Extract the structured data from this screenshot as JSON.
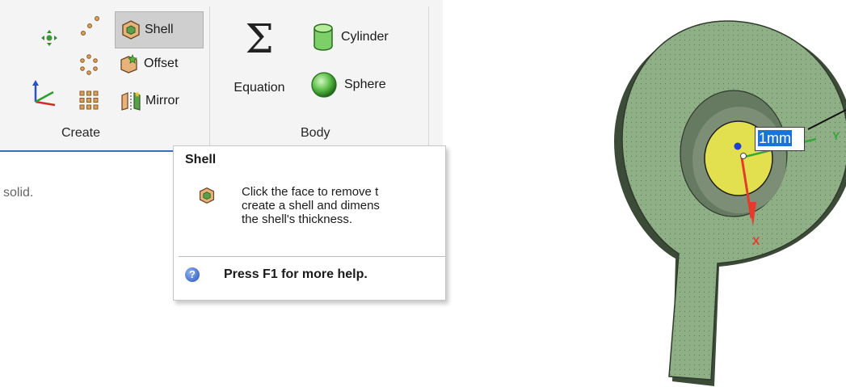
{
  "ribbon": {
    "create_group": {
      "label": "Create",
      "shell_label": "Shell",
      "offset_label": "Offset",
      "mirror_label": "Mirror"
    },
    "body_group": {
      "label": "Body",
      "equation_label": "Equation",
      "cylinder_label": "Cylinder",
      "sphere_label": "Sphere",
      "equation_symbol": "Σ"
    }
  },
  "status": {
    "text": "solid."
  },
  "tooltip": {
    "title": "Shell",
    "description_lines": [
      "Click the face to remove t",
      "create a shell and dimens",
      "the shell's thickness."
    ],
    "help_text": "Press F1 for more help.",
    "help_icon_glyph": "?"
  },
  "viewport": {
    "dimension_value": "1mm",
    "axis_x": "X",
    "axis_y": "Y",
    "colors": {
      "part_fill": "#8faf86",
      "inner_wall": "#667a62",
      "face_yellow": "#e3e050",
      "axis_x": "#e53b2c",
      "axis_y": "#3aa63a",
      "origin": "#2040d0"
    }
  },
  "icons": [
    "move-icon",
    "points-icon",
    "shell-icon",
    "pattern-icon",
    "offset-icon",
    "axes-icon",
    "grid-icon",
    "mirror-icon",
    "sigma-icon",
    "cylinder-icon",
    "sphere-icon",
    "shell-small-icon",
    "help-icon"
  ]
}
